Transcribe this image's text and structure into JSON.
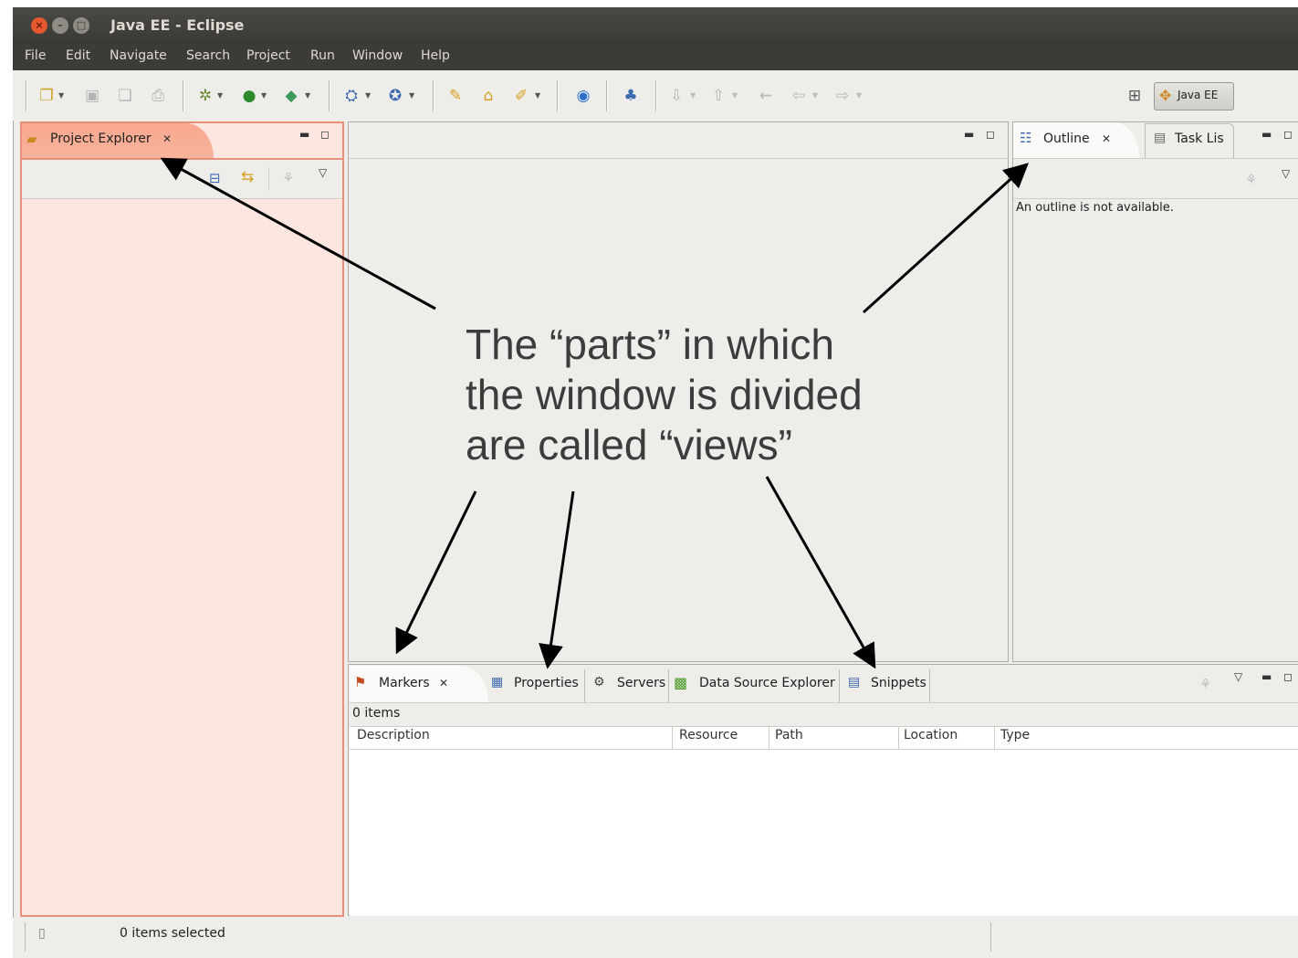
{
  "window": {
    "title": "Java EE - Eclipse"
  },
  "menu": [
    "File",
    "Edit",
    "Navigate",
    "Search",
    "Project",
    "Run",
    "Window",
    "Help"
  ],
  "perspective": {
    "label": "Java EE"
  },
  "project_explorer": {
    "tab_label": "Project Explorer"
  },
  "outline": {
    "tab_label": "Outline",
    "second_tab_label": "Task Lis",
    "message": "An outline is not available."
  },
  "bottom": {
    "tabs": [
      "Markers",
      "Properties",
      "Servers",
      "Data Source Explorer",
      "Snippets"
    ],
    "items_count": "0 items",
    "columns": [
      "Description",
      "Resource",
      "Path",
      "Location",
      "Type"
    ]
  },
  "status": {
    "text": "0 items selected"
  },
  "annotation": {
    "lines": [
      "The “parts” in which",
      "the window is divided",
      "are called “views”"
    ]
  },
  "colors": {
    "highlight": "#fde6df",
    "highlight_border": "#e8907a",
    "titlebar": "#3c3b37"
  }
}
